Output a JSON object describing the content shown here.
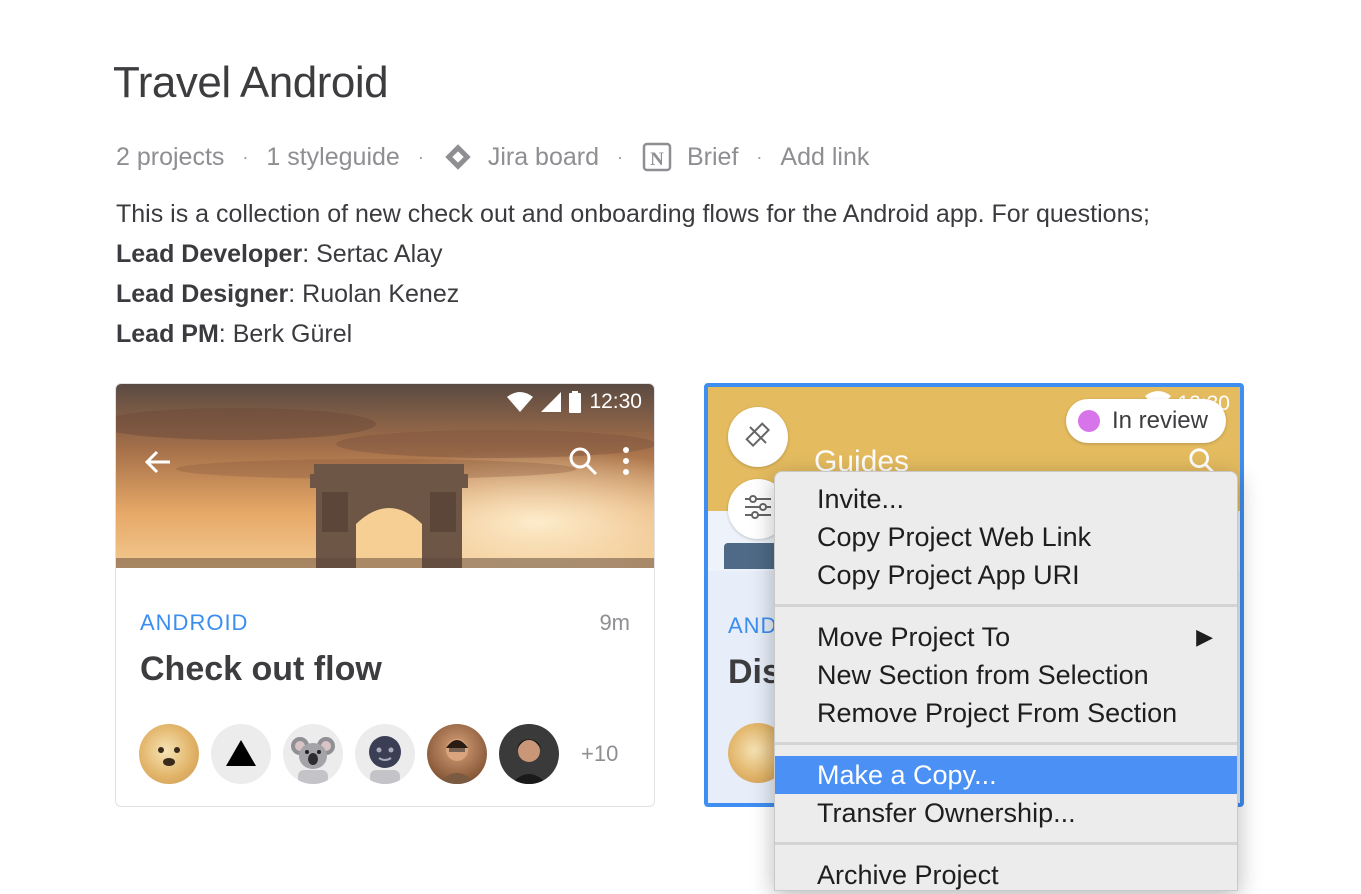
{
  "page": {
    "title": "Travel Android",
    "meta": {
      "projects": "2 projects",
      "styleguide": "1 styleguide",
      "jira": "Jira board",
      "brief": "Brief",
      "add_link": "Add link",
      "separator": "·"
    },
    "description": {
      "intro": "This is a collection of new check out and onboarding flows for the Android app. For questions;",
      "lines": [
        {
          "label": "Lead Developer",
          "value": ": Sertac Alay"
        },
        {
          "label": "Lead Designer",
          "value": ": Ruolan Kenez"
        },
        {
          "label": "Lead PM",
          "value": ": Berk Gürel"
        }
      ]
    }
  },
  "card1": {
    "status_time": "12:30",
    "platform": "ANDROID",
    "age": "9m",
    "title": "Check out flow",
    "avatars": [
      "doge-avatar",
      "triangle-avatar",
      "koala-avatar",
      "moon-avatar",
      "person-avatar",
      "person2-avatar"
    ],
    "more_count": "+10"
  },
  "card2": {
    "status_time": "12:30",
    "badge": "In review",
    "screen_title": "Guides",
    "platform_partial": "AND",
    "title_partial": "Dis"
  },
  "context_menu": {
    "items": [
      "Invite...",
      "Copy Project Web Link",
      "Copy Project App URI",
      "Move Project To",
      "New Section from Selection",
      "Remove Project From Section",
      "Make a Copy...",
      "Transfer Ownership...",
      "Archive Project"
    ],
    "submenu_arrow": "▶",
    "selected": "Make a Copy..."
  },
  "colors": {
    "accent": "#3f8ef2",
    "tag_blue": "#3b8df0",
    "review_dot": "#d874ea",
    "menu_highlight": "#4a90f5"
  }
}
